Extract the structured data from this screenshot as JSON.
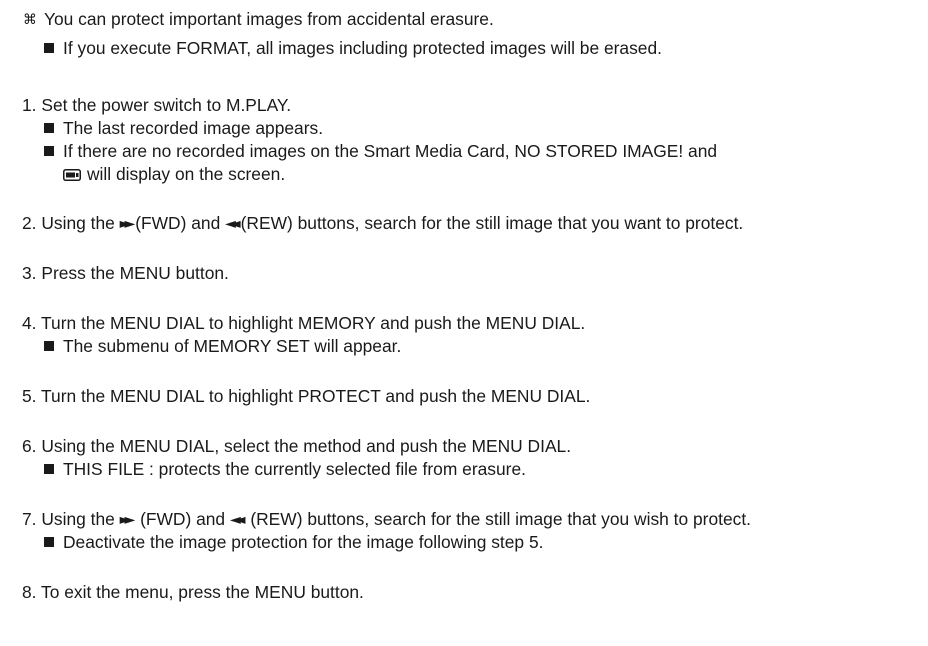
{
  "intro": {
    "symbol": "⌘",
    "text": "You can protect important images from accidental erasure.",
    "note": "If you execute FORMAT, all images including protected images will be erased."
  },
  "steps": [
    {
      "number": "1.",
      "text": "Set the power switch to M.PLAY.",
      "notes": [
        "The last recorded image appears.",
        "If there are no recorded images on the Smart Media Card, NO STORED IMAGE! and"
      ],
      "note_continuation": "will display on the screen.",
      "icon": "memory-card-icon"
    },
    {
      "number": "2.",
      "parts": [
        "Using the",
        "(FWD) and",
        "(REW) buttons, search for the still image that you want to protect."
      ],
      "icons": [
        "fast-forward-icon",
        "rewind-icon"
      ]
    },
    {
      "number": "3.",
      "text": "Press the MENU button."
    },
    {
      "number": "4.",
      "text": "Turn the MENU DIAL to highlight MEMORY and push the MENU DIAL.",
      "notes": [
        "The submenu of MEMORY SET will appear."
      ]
    },
    {
      "number": "5.",
      "text": "Turn the MENU DIAL to highlight PROTECT and push the MENU DIAL."
    },
    {
      "number": "6.",
      "text": "Using the MENU DIAL, select the method and push the MENU DIAL.",
      "notes": [
        "THIS FILE : protects the currently selected file from erasure."
      ]
    },
    {
      "number": "7.",
      "parts": [
        "Using the",
        "(FWD) and",
        "(REW) buttons, search for the still image that you wish to protect."
      ],
      "icons": [
        "fast-forward-icon",
        "rewind-icon"
      ],
      "notes": [
        "Deactivate the image protection for the image following step 5."
      ]
    },
    {
      "number": "8.",
      "text": "To exit the menu, press the MENU button."
    }
  ]
}
